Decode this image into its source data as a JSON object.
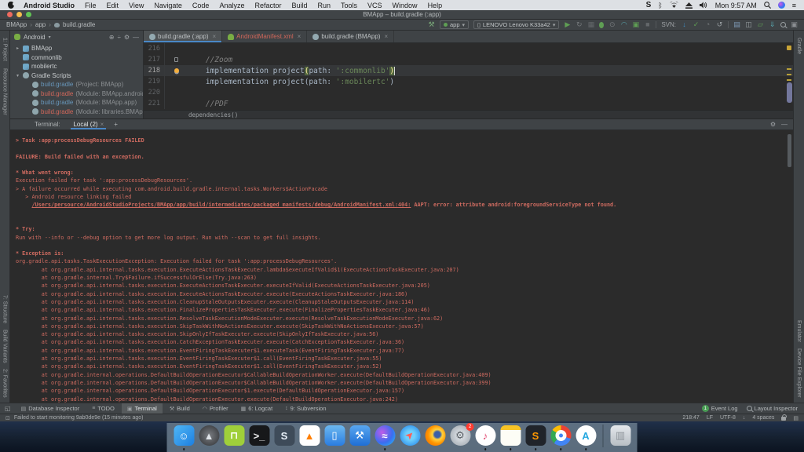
{
  "menubar": {
    "items": [
      "Android Studio",
      "File",
      "Edit",
      "View",
      "Navigate",
      "Code",
      "Analyze",
      "Refactor",
      "Build",
      "Run",
      "Tools",
      "VCS",
      "Window",
      "Help"
    ],
    "status": {
      "s": "S",
      "clock": "Mon 9:57 AM"
    }
  },
  "titlebar": {
    "title": "BMApp – build.gradle (:app)"
  },
  "toolbar": {
    "breadcrumb": [
      "BMApp",
      "app",
      "build.gradle"
    ],
    "items": [
      {
        "type": "icon",
        "name": "build-hammer-button",
        "g": "⚒",
        "c": "#79a978"
      },
      {
        "type": "combo",
        "name": "run-config-select",
        "label": "app",
        "dot": "#5f9e54"
      },
      {
        "type": "combo",
        "name": "device-select",
        "label": "LENOVO Lenovo K33a42",
        "dot": "phone"
      },
      {
        "type": "icon",
        "name": "run-button",
        "g": "▶",
        "c": "#5f9e54"
      },
      {
        "type": "icon",
        "name": "apply-changes-button",
        "g": "↻",
        "c": "#75797c"
      },
      {
        "type": "icon",
        "name": "apply-code-changes-button",
        "g": "▦",
        "c": "#63676a"
      },
      {
        "type": "icon",
        "name": "debug-button",
        "g": "",
        "c": "#5f9e54",
        "cls": "bug"
      },
      {
        "type": "icon",
        "name": "profile-button",
        "g": "⊙",
        "c": "#75797c"
      },
      {
        "type": "icon",
        "name": "profiler-button",
        "g": "◠",
        "c": "#57a0a8"
      },
      {
        "type": "icon",
        "name": "run-on-device-button",
        "g": "▣",
        "c": "#5f9e54"
      },
      {
        "type": "icon",
        "name": "stop-button",
        "g": "■",
        "c": "#63676a"
      },
      {
        "type": "sep"
      },
      {
        "type": "label",
        "name": "svn-label",
        "text": "SVN:"
      },
      {
        "type": "icon",
        "name": "vcs-update-button",
        "g": "↓",
        "c": "#3f8cc5"
      },
      {
        "type": "icon",
        "name": "vcs-commit-button",
        "g": "✓",
        "c": "#5f9e54"
      },
      {
        "type": "icon",
        "name": "vcs-history-button",
        "g": "◔",
        "c": "#75797c"
      },
      {
        "type": "icon",
        "name": "vcs-rollback-button",
        "g": "↺",
        "c": "#9aa0a3"
      },
      {
        "type": "sep"
      },
      {
        "type": "icon",
        "name": "project-structure-button",
        "g": "▤",
        "c": "#7d9ab5"
      },
      {
        "type": "icon",
        "name": "tool-windows-button",
        "g": "◫",
        "c": "#9aa0a3"
      },
      {
        "type": "icon",
        "name": "avd-manager-button",
        "g": "▱",
        "c": "#5f9e54"
      },
      {
        "type": "icon",
        "name": "sdk-manager-button",
        "g": "⇓",
        "c": "#57a0a8"
      },
      {
        "type": "icon",
        "name": "search-everywhere-button",
        "g": "",
        "c": "#9aa0a3",
        "cls": "mag"
      },
      {
        "type": "icon",
        "name": "presentation-mode-button",
        "g": "▣",
        "c": "#8a8e91"
      }
    ]
  },
  "strips": {
    "left_top": [
      "1: Project",
      "Resource Manager"
    ],
    "left_bottom": [
      "7: Structure",
      "Build Variants",
      "2: Favorites"
    ],
    "right_top": [
      "Gradle"
    ],
    "right_bottom": [
      "Emulator",
      "Device File Explorer"
    ]
  },
  "project": {
    "view": "Android",
    "tree": [
      {
        "arrow": "▸",
        "icon": "module",
        "label": "BMApp",
        "cls": "",
        "ann": "",
        "indent": 0
      },
      {
        "arrow": "",
        "icon": "module",
        "label": "commonlib",
        "cls": "",
        "ann": "",
        "indent": 0
      },
      {
        "arrow": "",
        "icon": "module",
        "label": "mobilertc",
        "cls": "",
        "ann": "",
        "indent": 0
      },
      {
        "arrow": "▾",
        "icon": "gradle",
        "label": "Gradle Scripts",
        "cls": "",
        "ann": "",
        "indent": 0
      },
      {
        "arrow": "",
        "icon": "gradle",
        "label": "build.gradle",
        "cls": "teal",
        "ann": "(Project: BMApp)",
        "indent": 1
      },
      {
        "arrow": "",
        "icon": "gradle",
        "label": "build.gradle",
        "cls": "red",
        "ann": "(Module: BMApp.android-pdf-v",
        "indent": 1
      },
      {
        "arrow": "",
        "icon": "gradle",
        "label": "build.gradle",
        "cls": "teal",
        "ann": "(Module: BMApp.app)",
        "indent": 1
      },
      {
        "arrow": "",
        "icon": "gradle",
        "label": "build.gradle",
        "cls": "red",
        "ann": "(Module: libraries.BMApp.comn",
        "indent": 1
      }
    ]
  },
  "editor": {
    "tabs": [
      {
        "label": "build.gradle (:app)",
        "icon": "gradle",
        "selected": true,
        "modified": false
      },
      {
        "label": "AndroidManifest.xml",
        "icon": "android",
        "selected": false,
        "modified": true
      },
      {
        "label": "build.gradle (BMApp)",
        "icon": "gradle",
        "selected": false,
        "modified": false
      }
    ],
    "lines": [
      {
        "num": "216",
        "parts": []
      },
      {
        "num": "217",
        "gutter": "mark",
        "parts": [
          {
            "t": "    //Zoom",
            "c": "comment"
          }
        ]
      },
      {
        "num": "218",
        "gutter": "bulb",
        "current": true,
        "caret": true,
        "parts": [
          {
            "t": "    implementation project",
            "c": "code"
          },
          {
            "t": "(",
            "c": "paren"
          },
          {
            "t": "path: ",
            "c": "code"
          },
          {
            "t": "':commonlib'",
            "c": "str"
          },
          {
            "t": ")",
            "c": "paren"
          }
        ]
      },
      {
        "num": "219",
        "parts": [
          {
            "t": "    implementation project(path: ",
            "c": "code"
          },
          {
            "t": "':mobilertc'",
            "c": "str"
          },
          {
            "t": ")",
            "c": "code"
          }
        ]
      },
      {
        "num": "220",
        "parts": []
      },
      {
        "num": "221",
        "parts": [
          {
            "t": "    //PDF",
            "c": "comment"
          }
        ]
      }
    ],
    "breadcrumb": "dependencies()"
  },
  "terminal": {
    "label": "Terminal:",
    "tab": "Local (2)",
    "lines": [
      {
        "t": "> Task :app:processDebugResources FAILED",
        "b": true
      },
      {
        "t": ""
      },
      {
        "t": "FAILURE: Build failed with an exception.",
        "b": true
      },
      {
        "t": ""
      },
      {
        "t": "* What went wrong:",
        "b": true
      },
      {
        "t": "Execution failed for task ':app:processDebugResources'."
      },
      {
        "t": "> A failure occurred while executing com.android.build.gradle.internal.tasks.Workers$ActionFacade"
      },
      {
        "t": "   > Android resource linking failed"
      },
      {
        "pre": "     ",
        "link": "/Users/persource/AndroidStudioProjects/BMApp/app/build/intermediates/packaged_manifests/debug/AndroidManifest.xml:404:",
        "post": " AAPT: error: attribute android:foregroundServiceType not found.",
        "b": true
      },
      {
        "t": ""
      },
      {
        "t": ""
      },
      {
        "t": "* Try:",
        "b": true
      },
      {
        "t": "Run with --info or --debug option to get more log output. Run with --scan to get full insights."
      },
      {
        "t": ""
      },
      {
        "t": "* Exception is:",
        "b": true
      },
      {
        "t": "org.gradle.api.tasks.TaskExecutionException: Execution failed for task ':app:processDebugResources'."
      },
      {
        "t": "        at org.gradle.api.internal.tasks.execution.ExecuteActionsTaskExecuter.lambda$executeIfValid$1(ExecuteActionsTaskExecuter.java:207)"
      },
      {
        "t": "        at org.gradle.internal.Try$Failure.ifSuccessfulOrElse(Try.java:263)"
      },
      {
        "t": "        at org.gradle.api.internal.tasks.execution.ExecuteActionsTaskExecuter.executeIfValid(ExecuteActionsTaskExecuter.java:205)"
      },
      {
        "t": "        at org.gradle.api.internal.tasks.execution.ExecuteActionsTaskExecuter.execute(ExecuteActionsTaskExecuter.java:186)"
      },
      {
        "t": "        at org.gradle.api.internal.tasks.execution.CleanupStaleOutputsExecuter.execute(CleanupStaleOutputsExecuter.java:114)"
      },
      {
        "t": "        at org.gradle.api.internal.tasks.execution.FinalizePropertiesTaskExecuter.execute(FinalizePropertiesTaskExecuter.java:46)"
      },
      {
        "t": "        at org.gradle.api.internal.tasks.execution.ResolveTaskExecutionModeExecuter.execute(ResolveTaskExecutionModeExecuter.java:62)"
      },
      {
        "t": "        at org.gradle.api.internal.tasks.execution.SkipTaskWithNoActionsExecuter.execute(SkipTaskWithNoActionsExecuter.java:57)"
      },
      {
        "t": "        at org.gradle.api.internal.tasks.execution.SkipOnlyIfTaskExecuter.execute(SkipOnlyIfTaskExecuter.java:56)"
      },
      {
        "t": "        at org.gradle.api.internal.tasks.execution.CatchExceptionTaskExecuter.execute(CatchExceptionTaskExecuter.java:36)"
      },
      {
        "t": "        at org.gradle.api.internal.tasks.execution.EventFiringTaskExecuter$1.executeTask(EventFiringTaskExecuter.java:77)"
      },
      {
        "t": "        at org.gradle.api.internal.tasks.execution.EventFiringTaskExecuter$1.call(EventFiringTaskExecuter.java:55)"
      },
      {
        "t": "        at org.gradle.api.internal.tasks.execution.EventFiringTaskExecuter$1.call(EventFiringTaskExecuter.java:52)"
      },
      {
        "t": "        at org.gradle.internal.operations.DefaultBuildOperationExecutor$CallableBuildOperationWorker.execute(DefaultBuildOperationExecutor.java:409)"
      },
      {
        "t": "        at org.gradle.internal.operations.DefaultBuildOperationExecutor$CallableBuildOperationWorker.execute(DefaultBuildOperationExecutor.java:399)"
      },
      {
        "t": "        at org.gradle.internal.operations.DefaultBuildOperationExecutor$1.execute(DefaultBuildOperationExecutor.java:157)"
      },
      {
        "t": "        at org.gradle.internal.operations.DefaultBuildOperationExecutor.execute(DefaultBuildOperationExecutor.java:242)"
      }
    ]
  },
  "bottom_bar": {
    "tabs": [
      {
        "label": "Database Inspector",
        "icon": "▤",
        "active": false
      },
      {
        "label": "TODO",
        "icon": "≡",
        "active": false
      },
      {
        "label": "Terminal",
        "icon": "▣",
        "active": true
      },
      {
        "label": "Build",
        "icon": "⚒",
        "active": false
      },
      {
        "label": "Profiler",
        "icon": "◠",
        "active": false
      },
      {
        "label": "6: Logcat",
        "icon": "▦",
        "active": false
      },
      {
        "label": "9: Subversion",
        "icon": "↕",
        "active": false
      }
    ],
    "event_log": "Event Log",
    "event_badge": "1",
    "layout_inspector": "Layout Inspector"
  },
  "statusbar": {
    "message": "Failed to start monitoring 9ab0de9e (15 minutes ago)",
    "position": "218:47",
    "line_sep": "LF",
    "encoding": "UTF-8",
    "indent": "4 spaces"
  },
  "dock": {
    "items": [
      {
        "name": "finder",
        "glyph": "☺",
        "bg": "linear-gradient(135deg,#4fb6f5,#1d7fe0)",
        "fg": "#ffffff",
        "running": true
      },
      {
        "name": "launchpad",
        "glyph": "▲",
        "bg": "radial-gradient(circle,#7a7d82,#2e3033)",
        "fg": "#dfe3e8",
        "round": true
      },
      {
        "name": "android-file-transfer",
        "glyph": "⊓",
        "bg": "#9fcf3a",
        "fg": "#ffffff"
      },
      {
        "name": "terminal",
        "glyph": ">_",
        "bg": "#17181a",
        "fg": "#e8e8e8"
      },
      {
        "name": "sublime-text",
        "glyph": "S",
        "bg": "#3e4b59",
        "fg": "#e8f0f8"
      },
      {
        "name": "vlc",
        "glyph": "▲",
        "bg": "#ffffff",
        "fg": "#ff7f00"
      },
      {
        "name": "simulator",
        "glyph": "▯",
        "bg": "linear-gradient(180deg,#6cb8f0,#2a7de1)",
        "fg": "#ffffff"
      },
      {
        "name": "xcode",
        "glyph": "⚒",
        "bg": "linear-gradient(180deg,#58a6f0,#1f6fd6)",
        "fg": "#ffffff"
      },
      {
        "name": "siri",
        "glyph": "≈",
        "bg": "radial-gradient(circle at 35% 35%,#c05ce8,#3b6df0 55%,#24c4f0)",
        "fg": "#ffffff",
        "round": true,
        "running": true
      },
      {
        "name": "safari",
        "glyph": "➤",
        "bg": "radial-gradient(circle,#6fd0fc 30%,#1a7ce8)",
        "fg": "#ff5e57",
        "round": true,
        "rot": true
      },
      {
        "name": "firefox",
        "glyph": "",
        "bg": "radial-gradient(circle at 60% 45%,#3a5fa8 18%,#ffd23f 30%,#ff9500 55%,#e66000)",
        "fg": "#ffffff",
        "round": true
      },
      {
        "name": "system-preferences",
        "glyph": "⚙",
        "bg": "radial-gradient(circle,#e8ecf0,#9aa2aa)",
        "fg": "#5a6066",
        "round": true,
        "badge": "2"
      },
      {
        "name": "itunes",
        "glyph": "♪",
        "bg": "#ffffff",
        "fg": "#e0426d",
        "round": true,
        "running": true
      },
      {
        "name": "notes",
        "glyph": "",
        "bg": "linear-gradient(180deg,#f7c325 24%,#fdfdf6 24%)",
        "fg": "#333333",
        "running": true
      },
      {
        "name": "sublime-merge",
        "glyph": "S",
        "bg": "#20242a",
        "fg": "#ff9800",
        "running": true
      },
      {
        "name": "chrome",
        "glyph": "",
        "bg": "conic-gradient(#ea4335 0 30%,#4285f4 30% 62%,#34a853 62% 84%,#fbbc05 84%)",
        "fg": "#ffffff",
        "round": true,
        "chrome": true,
        "running": true
      },
      {
        "name": "android-studio",
        "glyph": "A",
        "bg": "#ffffff",
        "fg": "#26a8e0",
        "round": true,
        "running": true
      }
    ],
    "trash": {
      "name": "trash",
      "glyph": "▥",
      "bg": "linear-gradient(180deg,#e4e8ec,#b8bec4)",
      "fg": "#8f959b"
    }
  }
}
